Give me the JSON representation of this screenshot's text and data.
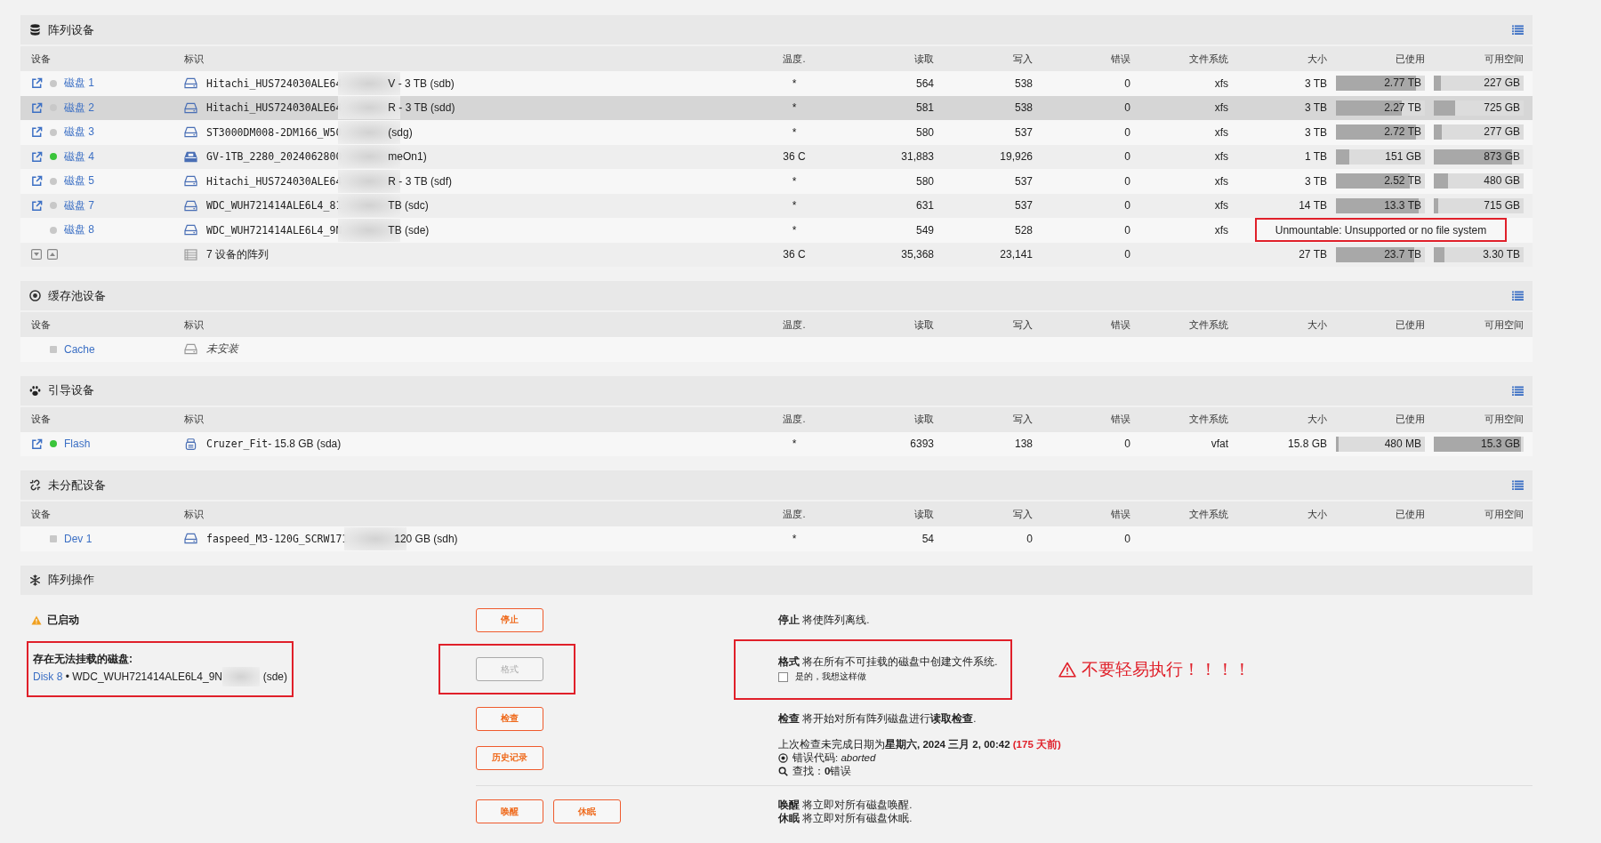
{
  "sections": [
    {
      "kind": "array",
      "title": "阵列设备",
      "columns": [
        "设备",
        "标识",
        "温度.",
        "读取",
        "写入",
        "错误",
        "文件系统",
        "大小",
        "已使用",
        "可用空间"
      ],
      "rows": [
        {
          "kind": "disk",
          "selected": false,
          "openable": true,
          "status": {
            "kind": "dot",
            "color": "#c8c8c8"
          },
          "device": "磁盘 1",
          "drive": {
            "kind": "hdd"
          },
          "id_head": "Hitachi_HUS724030ALE64",
          "redacted": true,
          "id_tail": "V - 3 TB (sdb)",
          "temp": "*",
          "reads": "564",
          "writes": "538",
          "errors": "0",
          "fs": "xfs",
          "size": "3 TB",
          "used": {
            "text": "2.77 TB",
            "level": 0.9
          },
          "free": {
            "text": "227 GB",
            "level": 0.08
          }
        },
        {
          "kind": "disk",
          "selected": true,
          "openable": true,
          "status": {
            "kind": "dot",
            "color": "#c8c8c8"
          },
          "device": "磁盘 2",
          "drive": {
            "kind": "hdd"
          },
          "id_head": "Hitachi_HUS724030ALE64",
          "redacted": true,
          "id_tail": "R - 3 TB (sdd)",
          "temp": "*",
          "reads": "581",
          "writes": "538",
          "errors": "0",
          "fs": "xfs",
          "size": "3 TB",
          "used": {
            "text": "2.27 TB",
            "level": 0.74
          },
          "free": {
            "text": "725 GB",
            "level": 0.24
          }
        },
        {
          "kind": "disk",
          "selected": false,
          "openable": true,
          "status": {
            "kind": "dot",
            "color": "#c8c8c8"
          },
          "device": "磁盘 3",
          "drive": {
            "kind": "hdd"
          },
          "id_head": "ST3000DM008-2DM166_W50",
          "redacted": true,
          "id_tail": "(sdg)",
          "temp": "*",
          "reads": "580",
          "writes": "537",
          "errors": "0",
          "fs": "xfs",
          "size": "3 TB",
          "used": {
            "text": "2.72 TB",
            "level": 0.9
          },
          "free": {
            "text": "277 GB",
            "level": 0.09
          }
        },
        {
          "kind": "disk",
          "selected": false,
          "openable": true,
          "status": {
            "kind": "dot",
            "color": "#3ac43a"
          },
          "device": "磁盘 4",
          "drive": {
            "kind": "nvme"
          },
          "id_head": "GV-1TB_2280_2024062800",
          "redacted": true,
          "id_tail": "meOn1)",
          "temp": "36 C",
          "reads": "31,883",
          "writes": "19,926",
          "errors": "0",
          "fs": "xfs",
          "size": "1 TB",
          "used": {
            "text": "151 GB",
            "level": 0.15
          },
          "free": {
            "text": "873 GB",
            "level": 0.87
          }
        },
        {
          "kind": "disk",
          "selected": false,
          "openable": true,
          "status": {
            "kind": "dot",
            "color": "#c8c8c8"
          },
          "device": "磁盘 5",
          "drive": {
            "kind": "hdd"
          },
          "id_head": "Hitachi_HUS724030ALE64",
          "redacted": true,
          "id_tail": "R - 3 TB (sdf)",
          "temp": "*",
          "reads": "580",
          "writes": "537",
          "errors": "0",
          "fs": "xfs",
          "size": "3 TB",
          "used": {
            "text": "2.52 TB",
            "level": 0.83
          },
          "free": {
            "text": "480 GB",
            "level": 0.16
          }
        },
        {
          "kind": "disk",
          "selected": false,
          "openable": true,
          "status": {
            "kind": "dot",
            "color": "#c8c8c8"
          },
          "device": "磁盘 7",
          "drive": {
            "kind": "hdd"
          },
          "id_head": "WDC_WUH721414ALE6L4_81",
          "redacted": true,
          "id_tail": "TB (sdc)",
          "temp": "*",
          "reads": "631",
          "writes": "537",
          "errors": "0",
          "fs": "xfs",
          "size": "14 TB",
          "used": {
            "text": "13.3 TB",
            "level": 0.93
          },
          "free": {
            "text": "715 GB",
            "level": 0.05
          }
        },
        {
          "kind": "disk",
          "selected": false,
          "openable": false,
          "status": {
            "kind": "dot",
            "color": "#c8c8c8"
          },
          "device": "磁盘 8",
          "drive": {
            "kind": "hdd"
          },
          "id_head": "WDC_WUH721414ALE6L4_9N",
          "redacted": true,
          "id_tail": "TB (sde)",
          "temp": "*",
          "reads": "549",
          "writes": "528",
          "errors": "0",
          "fs": "xfs",
          "message": "Unmountable: Unsupported or no file system",
          "highlighted": true
        }
      ],
      "footer": {
        "label": "7 设备的阵列",
        "temp": "36 C",
        "reads": "35,368",
        "writes": "23,141",
        "errors": "0",
        "size": "27 TB",
        "used": {
          "text": "23.7 TB",
          "level": 0.88
        },
        "free": {
          "text": "3.30 TB",
          "level": 0.12
        }
      }
    },
    {
      "kind": "cache",
      "title": "缓存池设备",
      "columns": [
        "设备",
        "标识",
        "温度.",
        "读取",
        "写入",
        "错误",
        "文件系统",
        "大小",
        "已使用",
        "可用空间"
      ],
      "rows": [
        {
          "kind": "missing",
          "selected": false,
          "openable": false,
          "status": {
            "kind": "square",
            "color": "#c8c8c8"
          },
          "device": "Cache",
          "drive": {
            "kind": "hdd"
          },
          "id_head": "未安装",
          "redacted": false
        }
      ]
    },
    {
      "kind": "boot",
      "title": "引导设备",
      "columns": [
        "设备",
        "标识",
        "温度.",
        "读取",
        "写入",
        "错误",
        "文件系统",
        "大小",
        "已使用",
        "可用空间"
      ],
      "rows": [
        {
          "kind": "disk",
          "selected": false,
          "openable": true,
          "status": {
            "kind": "dot",
            "color": "#3ac43a"
          },
          "device": "Flash",
          "drive": {
            "kind": "usb"
          },
          "id_head": "Cruzer_Fit",
          "redacted": false,
          "id_tail": " - 15.8 GB (sda)",
          "temp": "*",
          "reads": "6393",
          "writes": "138",
          "errors": "0",
          "fs": "vfat",
          "size": "15.8 GB",
          "used": {
            "text": "480 MB",
            "level": 0.03
          },
          "free": {
            "text": "15.3 GB",
            "level": 0.97
          }
        }
      ]
    },
    {
      "kind": "unassigned",
      "title": "未分配设备",
      "columns": [
        "设备",
        "标识",
        "温度.",
        "读取",
        "写入",
        "错误",
        "文件系统",
        "大小",
        "已使用",
        "可用空间"
      ],
      "rows": [
        {
          "kind": "disk",
          "selected": false,
          "openable": false,
          "status": {
            "kind": "square",
            "color": "#c8c8c8"
          },
          "device": "Dev 1",
          "drive": {
            "kind": "hdd"
          },
          "id_head": "faspeed_M3-120G_SCRW171",
          "redacted": true,
          "id_tail": "120 GB (sdh)",
          "temp": "*",
          "reads": "54",
          "writes": "0",
          "errors": "0"
        }
      ]
    }
  ],
  "operations": {
    "title": "阵列操作",
    "rows": [
      {
        "left": {
          "kind": "status",
          "text": "已启动"
        },
        "buttons": [
          {
            "label": "停止",
            "disabled": false
          }
        ],
        "desc": [
          "**停止** 将使阵列离线."
        ]
      },
      {
        "highlighted": true,
        "left": {
          "kind": "notice",
          "title": "存在无法挂载的磁盘:",
          "link": "Disk 8",
          "text": "• WDC_WUH721414ALE6L4_9N",
          "redacted": true,
          "tail": "(sde)"
        },
        "buttons": [
          {
            "label": "格式",
            "disabled": true
          }
        ],
        "desc": [
          "**格式** 将在所有不可挂载的磁盘中创建文件系统."
        ],
        "confirm": {
          "label": "是的，我想这样做",
          "checked": false
        },
        "warning": "不要轻易执行！！！！"
      },
      {
        "buttons": [
          {
            "label": "检查",
            "disabled": false
          }
        ],
        "desc": [
          "**检查** 将开始对所有阵列磁盘进行**读取检查**."
        ]
      },
      {
        "buttons": [
          {
            "label": "历史记录",
            "disabled": false
          }
        ],
        "last_check": {
          "text": "上次检查未完成日期为**星期六, 2024 三月 2, 00:42**",
          "age": "(175 天前)",
          "error_code": "错误代码: *aborted*",
          "found": "查找：**0**错误"
        }
      },
      {
        "separated": true,
        "buttons": [
          {
            "label": "唤醒",
            "disabled": false
          },
          {
            "label": "休眠",
            "disabled": false
          }
        ],
        "desc": [
          "**唤醒** 将立即对所有磁盘唤醒.",
          "**休眠** 将立即对所有磁盘休眠."
        ]
      }
    ]
  }
}
